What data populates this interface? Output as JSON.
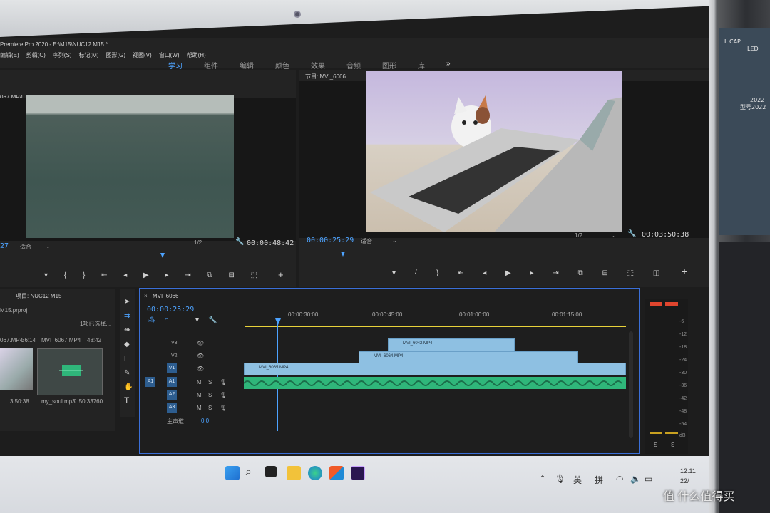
{
  "app": {
    "title": "Premiere Pro 2020 - E:\\M15\\NUC12 M15 *",
    "menus": [
      "编辑(E)",
      "剪辑(C)",
      "序列(S)",
      "标记(M)",
      "图形(G)",
      "视图(V)",
      "窗口(W)",
      "帮助(H)"
    ],
    "workspaces": [
      "学习",
      "组件",
      "编辑",
      "颜色",
      "效果",
      "音频",
      "图形",
      "库"
    ],
    "workspace_overflow": "»"
  },
  "source_monitor": {
    "tab": "067.MP4",
    "timecode_left": "27",
    "fit_label": "适合",
    "resolution": "1/2",
    "duration": "00:00:48:42"
  },
  "program_monitor": {
    "tab": "节目: MVI_6066",
    "timecode": "00:00:25:29",
    "fit_label": "适合",
    "resolution": "1/2",
    "duration": "00:03:50:38"
  },
  "project": {
    "tab": "项目: NUC12 M15",
    "file": "M15.prproj",
    "selection": "1项已选择...",
    "items": [
      {
        "name": "067.MP4",
        "duration": "36:14"
      },
      {
        "name": "MVI_6067.MP4",
        "duration": "48:42"
      },
      {
        "name": "my_soul.mp3",
        "duration": "1:50:33760"
      },
      {
        "name": "",
        "duration": "3:50:38"
      }
    ]
  },
  "timeline": {
    "tab": "MVI_6066",
    "timecode": "00:00:25:29",
    "ruler": [
      "00:00:30:00",
      "00:00:45:00",
      "00:01:00:00",
      "00:01:15:00"
    ],
    "video_tracks": [
      "V3",
      "V2",
      "V1"
    ],
    "audio_tracks": [
      "A1",
      "A2",
      "A3"
    ],
    "source_patch": [
      "V1",
      "A1"
    ],
    "master": {
      "label": "主声道",
      "value": "0.0"
    },
    "clips": [
      {
        "name": "MVI_6042.MP4",
        "track": "V3"
      },
      {
        "name": "MVI_6064.MP4",
        "track": "V2"
      },
      {
        "name": "MVI_6065.MP4",
        "track": "V1"
      }
    ],
    "track_buttons": [
      "M",
      "S"
    ]
  },
  "audio_meter": {
    "scale": [
      "-6",
      "-12",
      "-18",
      "-24",
      "-30",
      "-36",
      "-42",
      "-48",
      "-54",
      "dB"
    ],
    "solo": [
      "S",
      "S"
    ]
  },
  "taskbar": {
    "tray_lang": "英",
    "tray_ime": "拼",
    "clock_time": "12:11",
    "clock_date": "22/"
  },
  "desktop_side": {
    "icons": [
      "L CAP",
      "LED",
      "2022",
      "型号2022"
    ]
  },
  "watermark": "值 什么值得买",
  "colors": {
    "accent_blue": "#4da3ff",
    "clip_blue": "#8ec0e2",
    "audio_green": "#2fb67a",
    "work_area_yellow": "#e8d23a"
  }
}
